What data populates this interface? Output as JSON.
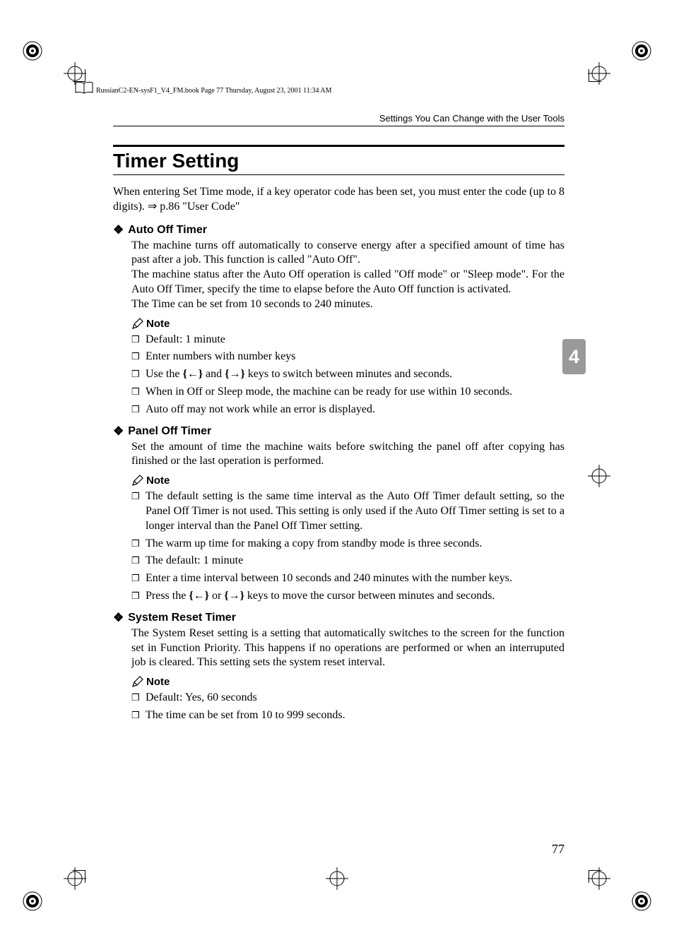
{
  "header_line": "RussianC2-EN-sysF1_V4_FM.book  Page 77  Thursday, August 23, 2001  11:34 AM",
  "running_head": "Settings You Can Change with the User Tools",
  "h1": "Timer Setting",
  "intro": "When entering Set Time mode, if a key operator code has been set, you must enter the code (up to 8 digits). ⇒ p.86 \"User Code\"",
  "tab_number": "4",
  "page_number": "77",
  "sections": {
    "auto_off": {
      "title": "Auto Off Timer",
      "body": "The machine turns off automatically to conserve energy after a specified amount of time has past after a job. This function is called \"Auto Off\".\nThe machine status after the Auto Off operation is called \"Off mode\" or \"Sleep mode\". For the Auto Off Timer, specify the time to elapse before the Auto Off function is activated.\nThe Time can be set from 10 seconds to 240 minutes.",
      "note_label": "Note",
      "notes": [
        "Default: 1 minute",
        "Enter numbers with number keys",
        "Use the {←} and {→} keys to switch between minutes and seconds.",
        "When in Off or Sleep mode, the machine can be ready for use within 10 seconds.",
        "Auto off may not work while an error is displayed."
      ]
    },
    "panel_off": {
      "title": "Panel Off Timer",
      "body": "Set the amount of time the machine waits before switching the panel off after copying has finished or the last operation is performed.",
      "note_label": "Note",
      "notes": [
        "The default setting is the same time interval as the Auto Off Timer default setting, so the Panel Off Timer is not used. This setting is only used if the Auto Off Timer setting is set to a longer interval than the Panel Off Timer setting.",
        "The warm up time for making a copy from standby mode is three seconds.",
        "The default: 1 minute",
        "Enter a time interval between 10 seconds and 240 minutes with the number keys.",
        "Press the {←} or {→} keys to move the cursor between minutes and seconds."
      ]
    },
    "system_reset": {
      "title": "System Reset Timer",
      "body": "The System Reset setting is a setting that automatically switches to the screen for the function set in Function Priority. This happens if no operations are performed or when an interruputed job is cleared. This setting sets the system reset interval.",
      "note_label": "Note",
      "notes": [
        "Default: Yes, 60 seconds",
        "The time can be set from 10 to 999 seconds."
      ]
    }
  }
}
